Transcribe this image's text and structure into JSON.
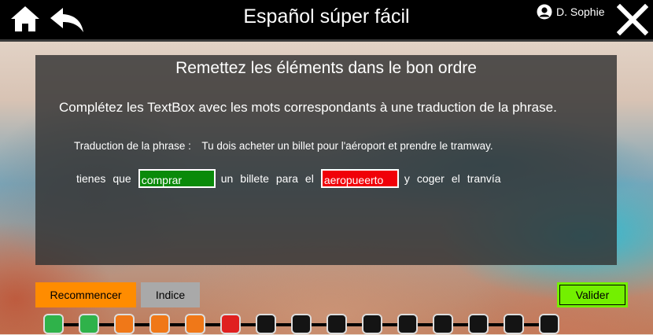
{
  "header": {
    "title": "Español súper fácil",
    "user_name": "D. Sophie"
  },
  "panel": {
    "title": "Remettez les éléments dans le bon ordre",
    "instruction": "Complétez les TextBox avec les mots correspondants à une traduction de la phrase.",
    "translation_label": "Traduction de la phrase :",
    "translation_text": "Tu dois acheter un billet pour l'aéroport et prendre le tramway.",
    "sentence": [
      {
        "type": "word",
        "text": "tienes"
      },
      {
        "type": "word",
        "text": "que"
      },
      {
        "type": "input",
        "value": "comprar",
        "status": "correct"
      },
      {
        "type": "word",
        "text": "un"
      },
      {
        "type": "word",
        "text": "billete"
      },
      {
        "type": "word",
        "text": "para"
      },
      {
        "type": "word",
        "text": "el"
      },
      {
        "type": "input",
        "value": "aeropueerto",
        "status": "incorrect"
      },
      {
        "type": "word",
        "text": "y"
      },
      {
        "type": "word",
        "text": "coger"
      },
      {
        "type": "word",
        "text": "el"
      },
      {
        "type": "word",
        "text": "tranvía"
      }
    ]
  },
  "buttons": {
    "restart": "Recommencer",
    "hint": "Indice",
    "validate": "Valider"
  },
  "progress": {
    "steps": [
      "correct",
      "correct",
      "partial",
      "partial",
      "partial",
      "incorrect",
      "pending",
      "pending",
      "pending",
      "pending",
      "pending",
      "pending",
      "pending",
      "pending",
      "pending"
    ]
  },
  "colors": {
    "correct": "#2fb24a",
    "partial": "#f07818",
    "incorrect": "#e02020",
    "pending": "#141414",
    "restart_button": "#ff8c00",
    "hint_button": "#a9a9a9",
    "validate_button": "#73f000",
    "correct_input": "#0a8a0a",
    "incorrect_input": "#f00008"
  }
}
